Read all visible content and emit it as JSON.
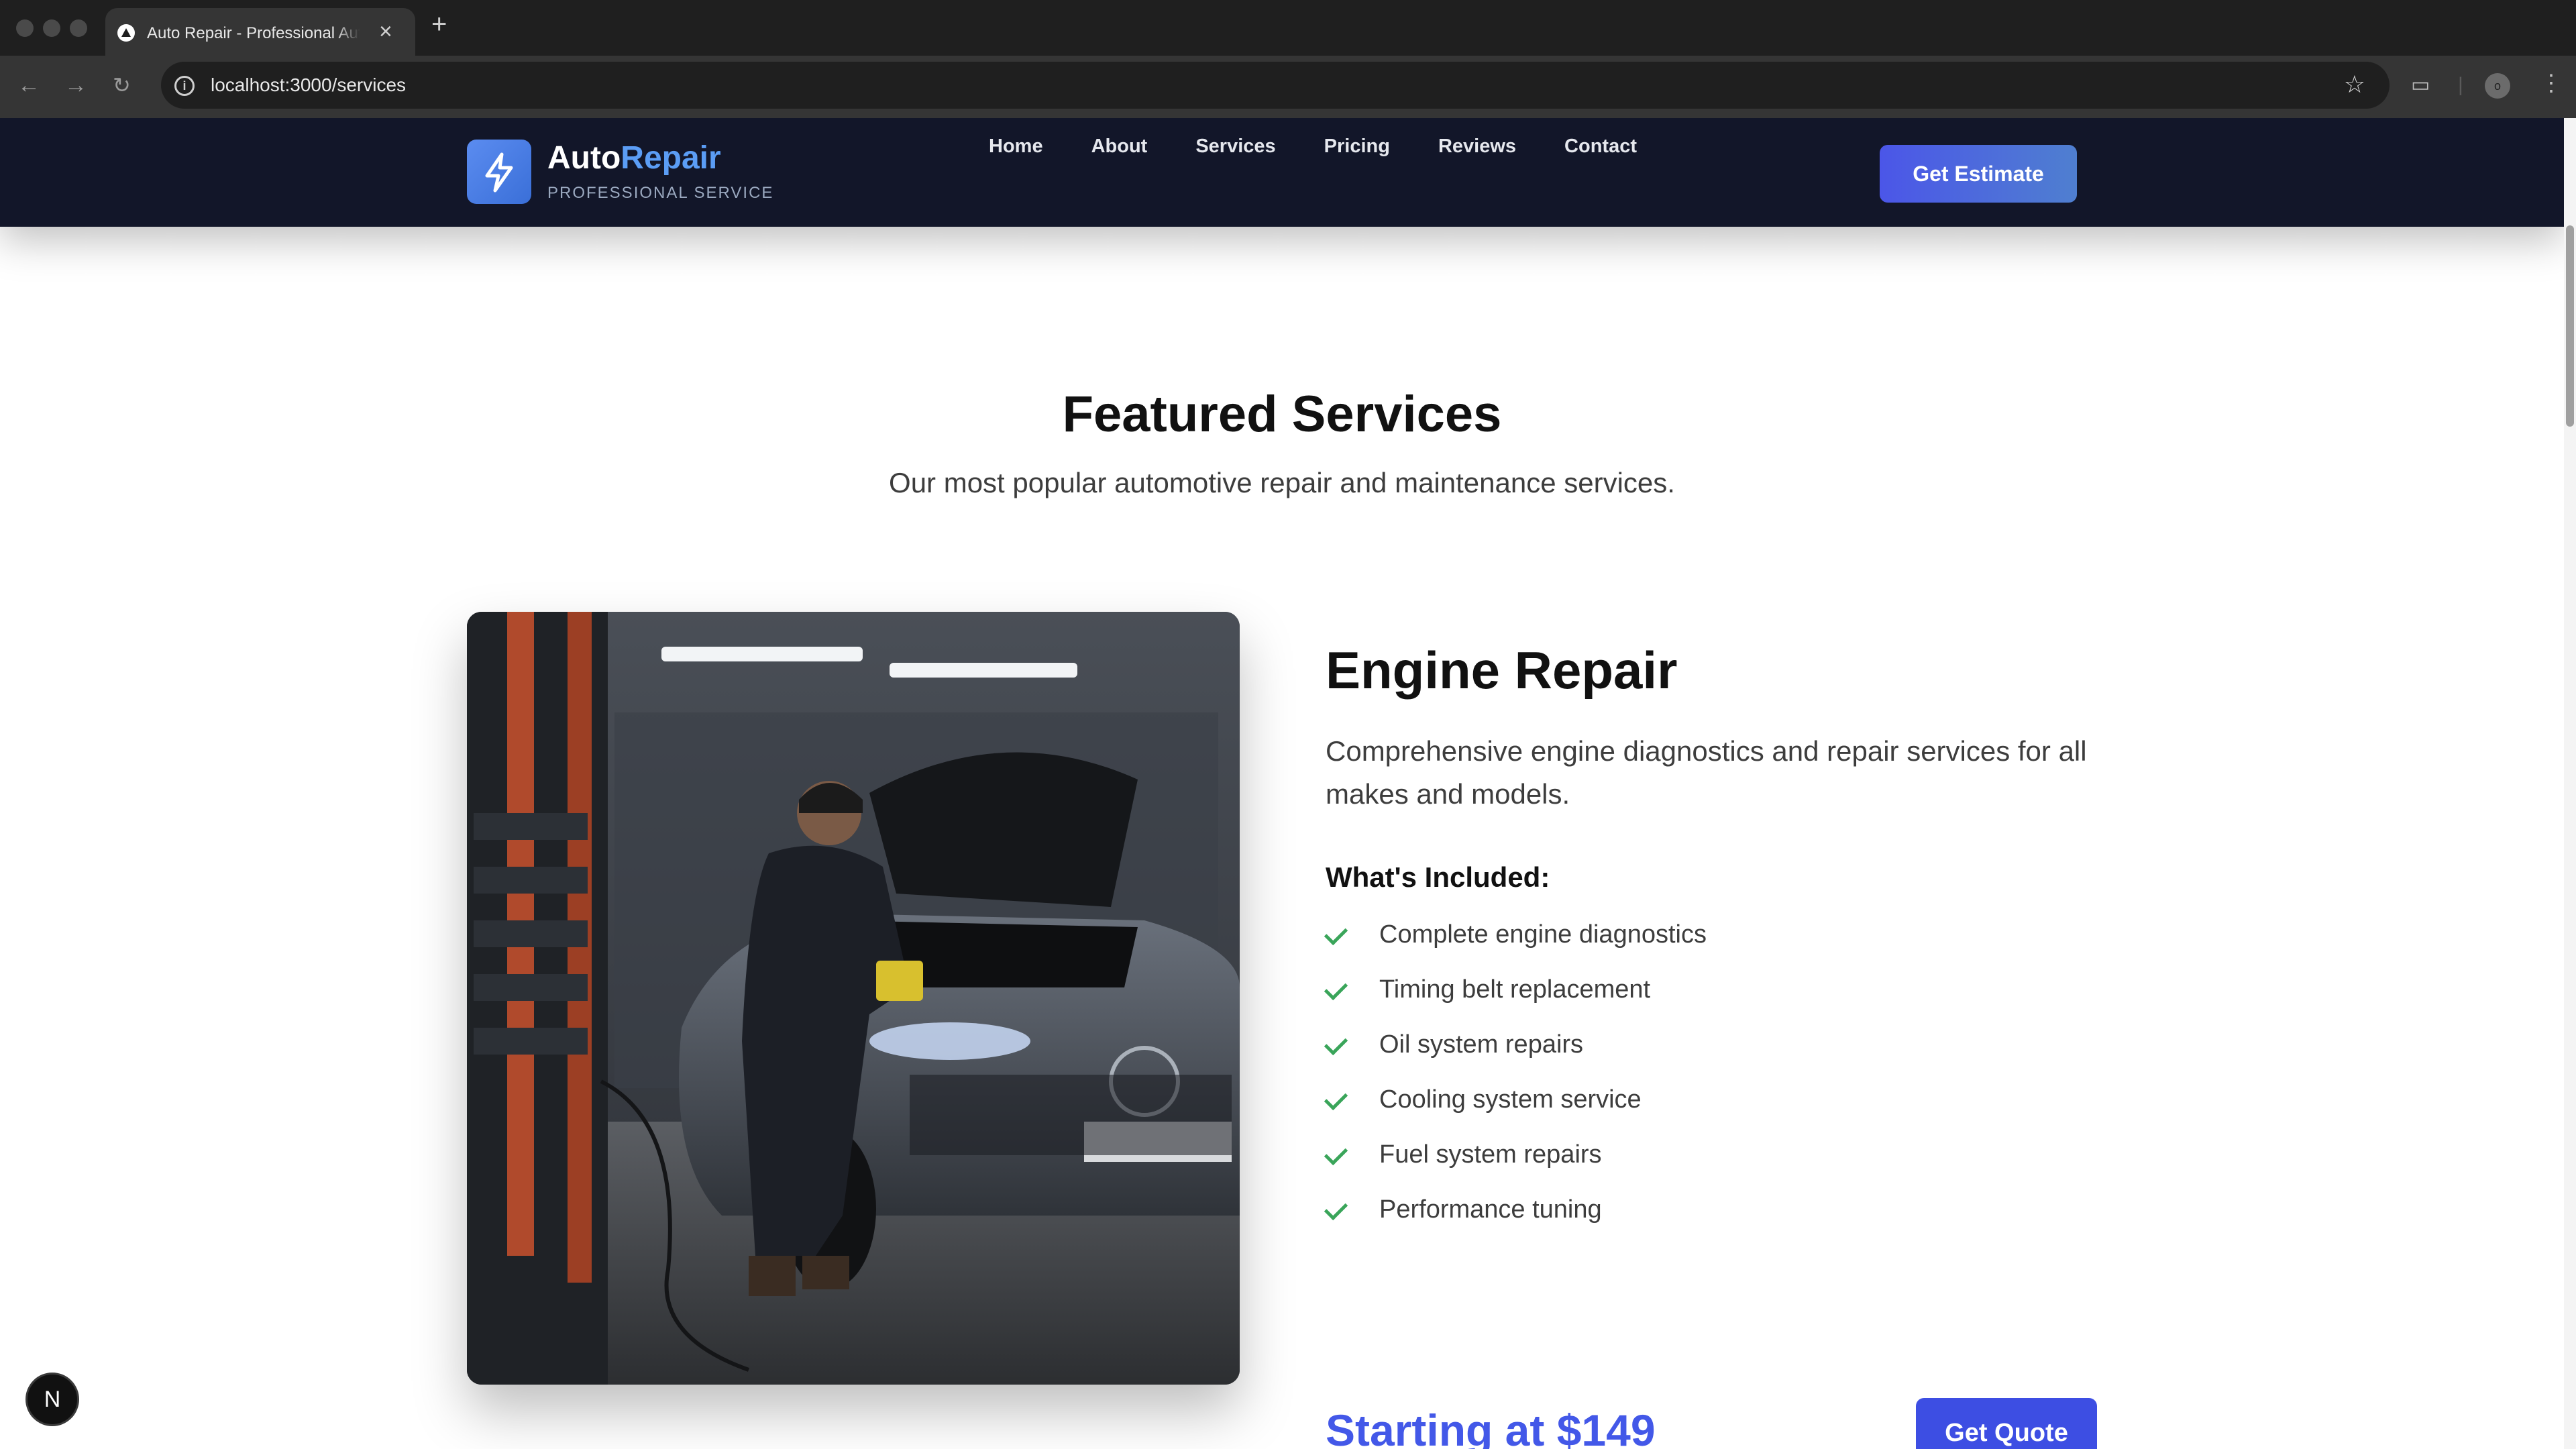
{
  "browser": {
    "tab_title": "Auto Repair - Professional Auto Repair Services",
    "new_tab_icon": "plus-icon",
    "url": "localhost:3000/services",
    "profile_initial": "o"
  },
  "header": {
    "brand_primary": "Auto",
    "brand_accent": "Repair",
    "brand_sub": "PROFESSIONAL SERVICE",
    "nav": [
      "Home",
      "About",
      "Services",
      "Pricing",
      "Reviews",
      "Contact"
    ],
    "cta_label": "Get Estimate"
  },
  "section": {
    "title": "Featured Services",
    "subtitle": "Our most popular automotive repair and maintenance services."
  },
  "service": {
    "title": "Engine Repair",
    "description": "Comprehensive engine diagnostics and repair services for all makes and models.",
    "included_title": "What's Included:",
    "features": [
      "Complete engine diagnostics",
      "Timing belt replacement",
      "Oil system repairs",
      "Cooling system service",
      "Fuel system repairs",
      "Performance tuning"
    ],
    "price": "Starting at $149",
    "quote_label": "Get Quote"
  },
  "colors": {
    "header_bg": "#121629",
    "accent": "#4358e8",
    "brand_accent": "#5b9df5",
    "check": "#3aa55a"
  },
  "dev_badge": "N"
}
